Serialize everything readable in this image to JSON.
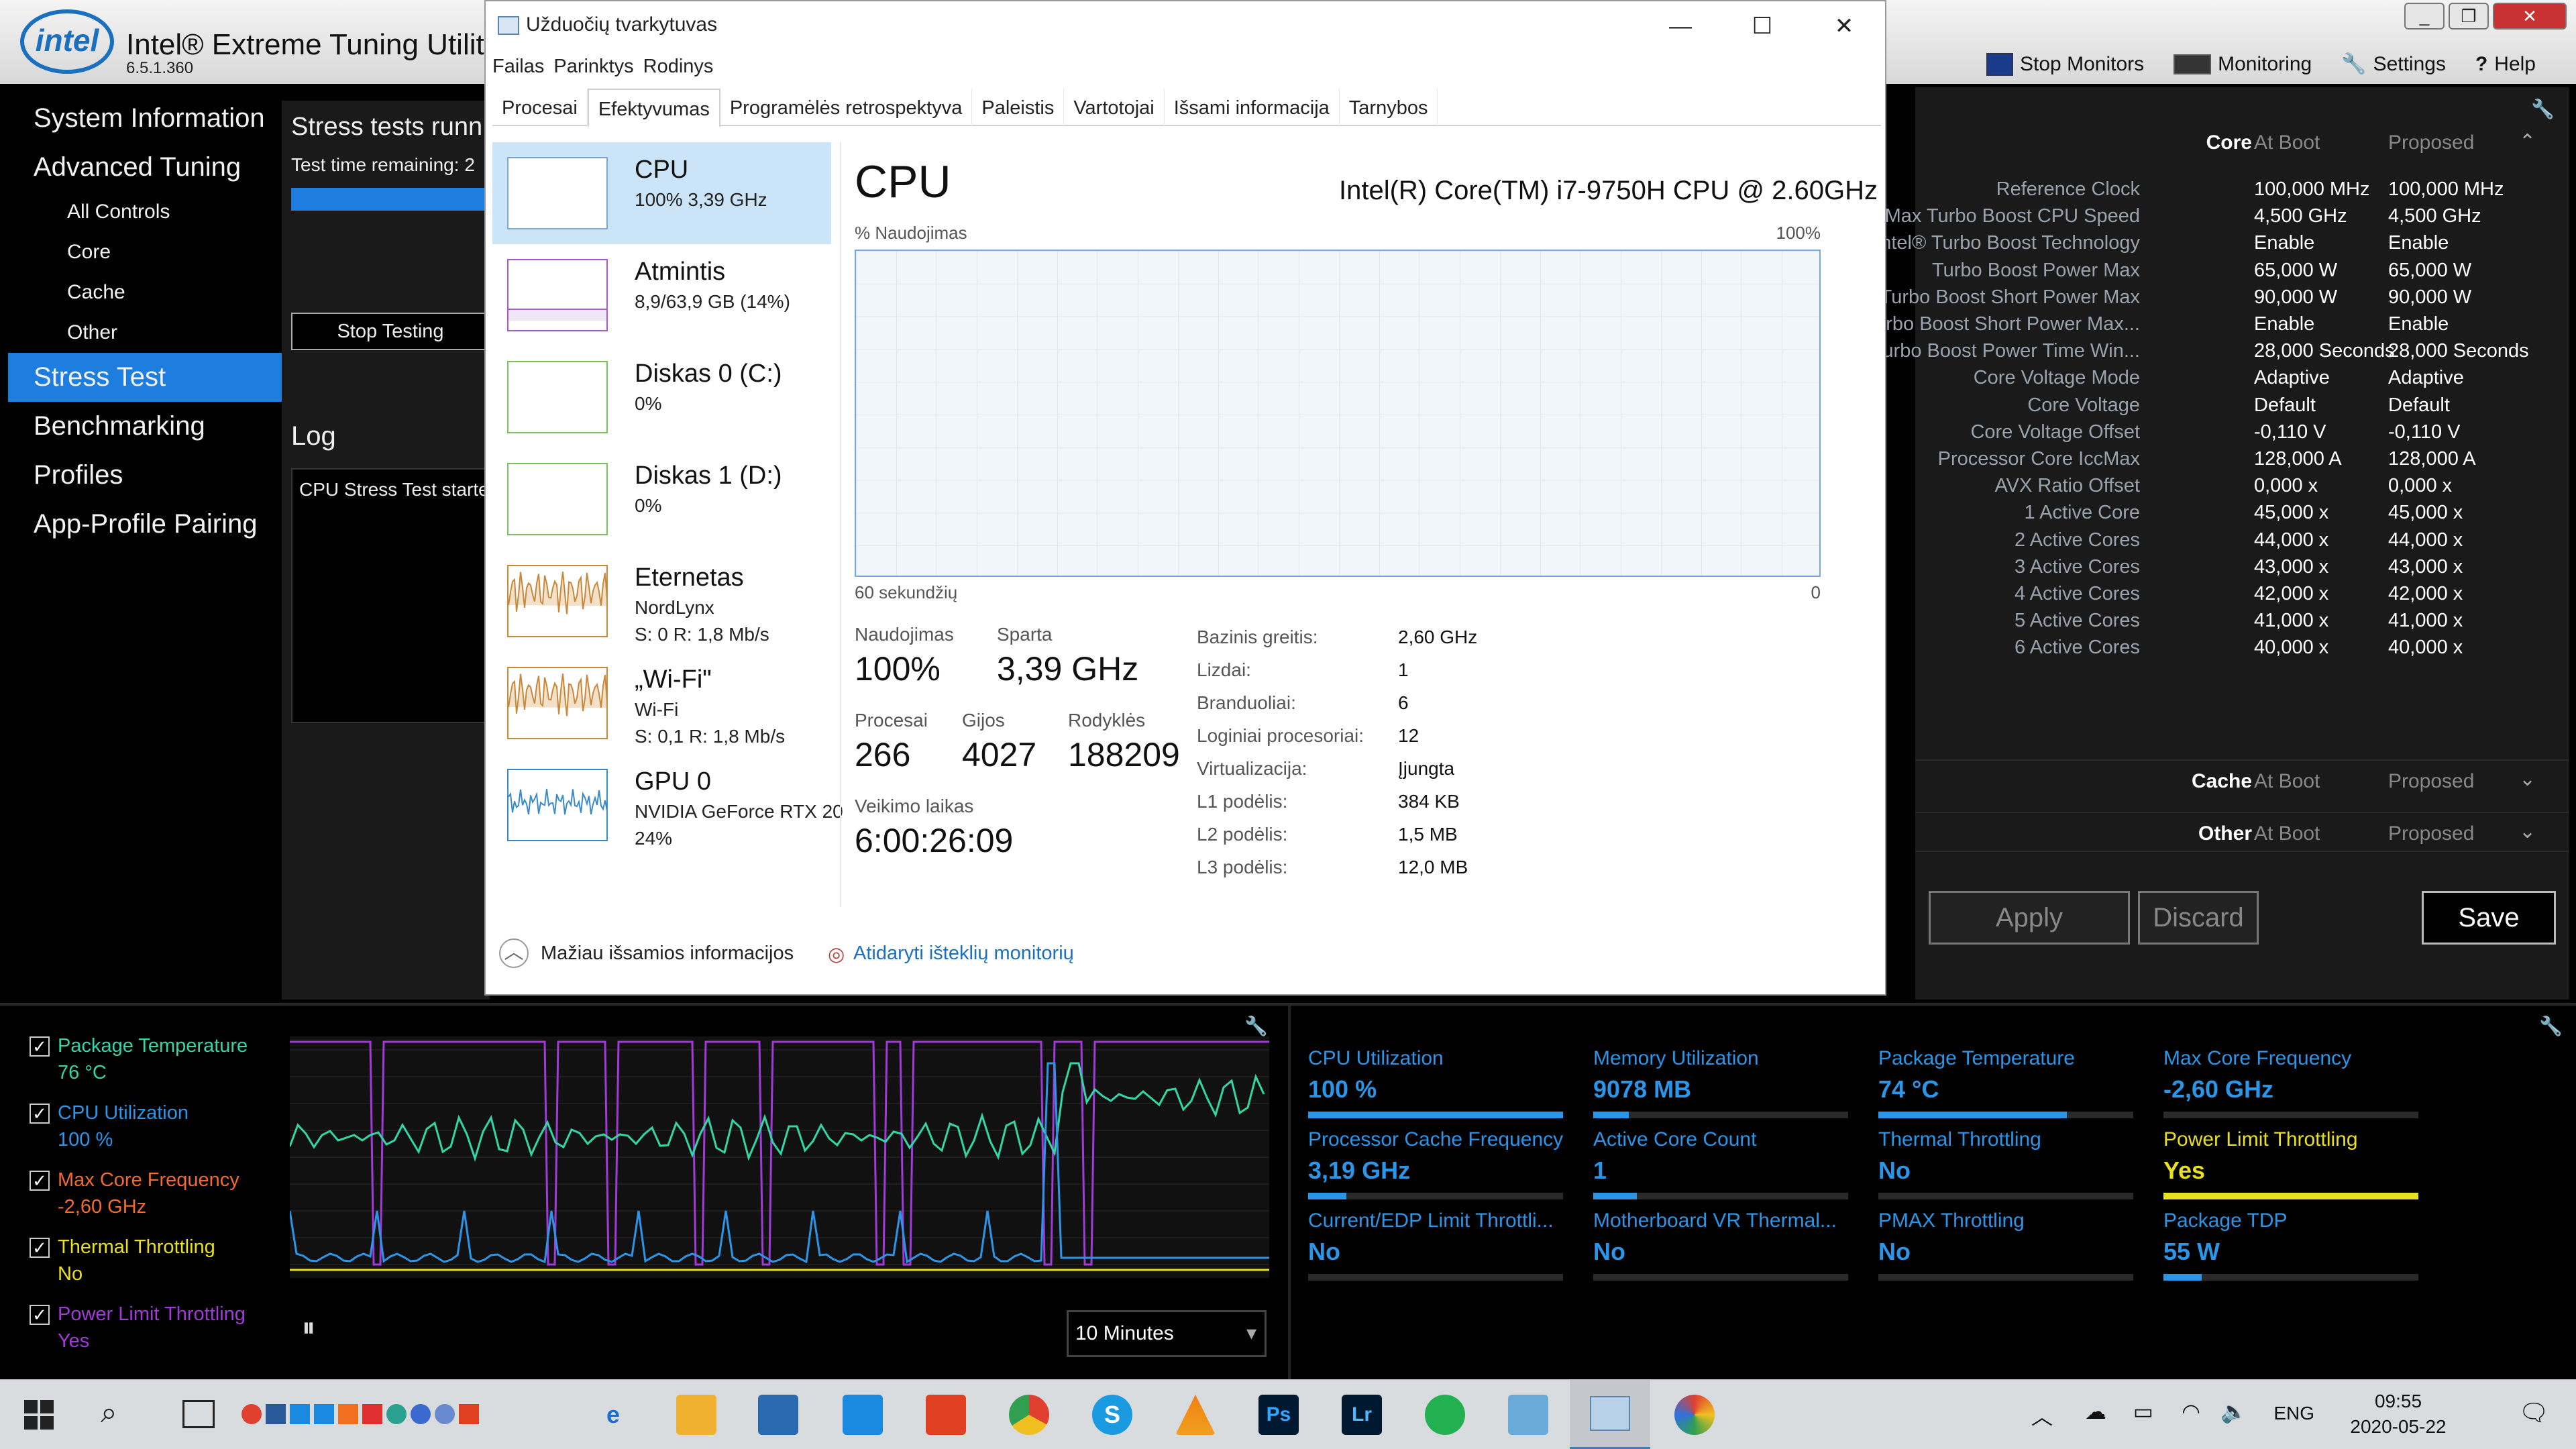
{
  "xtu": {
    "title": "Intel® Extreme Tuning Utility",
    "version": "6.5.1.360",
    "menu": [
      "Stop Monitors",
      "Monitoring",
      "Settings",
      "Help"
    ],
    "nav": [
      {
        "label": "System Information",
        "sub": false
      },
      {
        "label": "Advanced Tuning",
        "sub": false
      },
      {
        "label": "All Controls",
        "sub": true
      },
      {
        "label": "Core",
        "sub": true
      },
      {
        "label": "Cache",
        "sub": true
      },
      {
        "label": "Other",
        "sub": true
      },
      {
        "label": "Stress Test",
        "sub": false,
        "active": true
      },
      {
        "label": "Benchmarking",
        "sub": false
      },
      {
        "label": "Profiles",
        "sub": false
      },
      {
        "label": "App-Profile Pairing",
        "sub": false
      }
    ],
    "stress": {
      "title": "Stress tests runn",
      "time_label": "Test time remaining: 2",
      "stop_button": "Stop Testing",
      "log_title": "Log",
      "log_text": "CPU Stress Test starte"
    },
    "right": {
      "header": {
        "core": "Core",
        "at_boot": "At Boot",
        "proposed": "Proposed"
      },
      "rows": [
        {
          "label": "Reference Clock",
          "boot": "100,000 MHz",
          "prop": "100,000 MHz"
        },
        {
          "label": "Max Turbo Boost CPU Speed",
          "boot": "4,500 GHz",
          "prop": "4,500 GHz"
        },
        {
          "label": "Intel® Turbo Boost Technology",
          "boot": "Enable",
          "prop": "Enable"
        },
        {
          "label": "Turbo Boost Power Max",
          "boot": "65,000 W",
          "prop": "65,000 W"
        },
        {
          "label": "Turbo Boost Short Power Max",
          "boot": "90,000 W",
          "prop": "90,000 W"
        },
        {
          "label": "Turbo Boost Short Power Max...",
          "boot": "Enable",
          "prop": "Enable"
        },
        {
          "label": "Turbo Boost Power Time Win...",
          "boot": "28,000 Seconds",
          "prop": "28,000 Seconds"
        },
        {
          "label": "Core Voltage Mode",
          "boot": "Adaptive",
          "prop": "Adaptive"
        },
        {
          "label": "Core Voltage",
          "boot": "Default",
          "prop": "Default"
        },
        {
          "label": "Core Voltage Offset",
          "boot": "-0,110 V",
          "prop": "-0,110 V"
        },
        {
          "label": "Processor Core IccMax",
          "boot": "128,000 A",
          "prop": "128,000 A"
        },
        {
          "label": "AVX Ratio Offset",
          "boot": "0,000 x",
          "prop": "0,000 x"
        },
        {
          "label": "1 Active Core",
          "boot": "45,000 x",
          "prop": "45,000 x"
        },
        {
          "label": "2 Active Cores",
          "boot": "44,000 x",
          "prop": "44,000 x"
        },
        {
          "label": "3 Active Cores",
          "boot": "43,000 x",
          "prop": "43,000 x"
        },
        {
          "label": "4 Active Cores",
          "boot": "42,000 x",
          "prop": "42,000 x"
        },
        {
          "label": "5 Active Cores",
          "boot": "41,000 x",
          "prop": "41,000 x"
        },
        {
          "label": "6 Active Cores",
          "boot": "40,000 x",
          "prop": "40,000 x"
        }
      ],
      "cache": {
        "label": "Cache",
        "at_boot": "At Boot",
        "proposed": "Proposed"
      },
      "other": {
        "label": "Other",
        "at_boot": "At Boot",
        "proposed": "Proposed"
      },
      "buttons": {
        "apply": "Apply",
        "discard": "Discard",
        "save": "Save"
      }
    },
    "monitor": {
      "items": [
        {
          "name": "Package Temperature",
          "value": "76 °C",
          "color": "#33d6a6"
        },
        {
          "name": "CPU Utilization",
          "value": "100 %",
          "color": "#2b95e8"
        },
        {
          "name": "Max Core Frequency",
          "value": "-2,60 GHz",
          "color": "#f26b2a"
        },
        {
          "name": "Thermal Throttling",
          "value": "No",
          "color": "#e8e020"
        },
        {
          "name": "Power Limit Throttling",
          "value": "Yes",
          "color": "#a03ad8"
        }
      ],
      "time_range": "10 Minutes",
      "stats": [
        {
          "name": "CPU Utilization",
          "value": "100 %",
          "fill": 1.0,
          "color": "#2b95e8"
        },
        {
          "name": "Memory Utilization",
          "value": "9078  MB",
          "fill": 0.14,
          "color": "#2b95e8"
        },
        {
          "name": "Package Temperature",
          "value": "74 °C",
          "fill": 0.74,
          "color": "#2b95e8"
        },
        {
          "name": "Max Core Frequency",
          "value": "-2,60 GHz",
          "fill": 0,
          "color": "#2b95e8"
        },
        {
          "name": "Processor Cache Frequency",
          "value": "3,19 GHz",
          "fill": 0.15,
          "color": "#2b95e8"
        },
        {
          "name": "Active Core Count",
          "value": "1",
          "fill": 0.17,
          "color": "#2b95e8"
        },
        {
          "name": "Thermal Throttling",
          "value": "No",
          "fill": 0,
          "color": "#2b95e8"
        },
        {
          "name": "Power Limit Throttling",
          "value": "Yes",
          "fill": 1.0,
          "color": "#e8e020"
        },
        {
          "name": "Current/EDP Limit Throttli...",
          "value": "No",
          "fill": 0,
          "color": "#2b95e8"
        },
        {
          "name": "Motherboard VR Thermal...",
          "value": "No",
          "fill": 0,
          "color": "#2b95e8"
        },
        {
          "name": "PMAX Throttling",
          "value": "No",
          "fill": 0,
          "color": "#2b95e8"
        },
        {
          "name": "Package TDP",
          "value": "55 W",
          "fill": 0.15,
          "color": "#2b95e8"
        }
      ]
    }
  },
  "tm": {
    "title": "Užduočių tvarkytuvas",
    "menu": [
      "Failas",
      "Parinktys",
      "Rodinys"
    ],
    "tabs": [
      "Procesai",
      "Efektyvumas",
      "Programėlės retrospektyva",
      "Paleistis",
      "Vartotojai",
      "Išsami informacija",
      "Tarnybos"
    ],
    "active_tab": 1,
    "list": [
      {
        "name": "CPU",
        "s1": "100%  3,39 GHz",
        "s2": "",
        "color": "#7aa7d8"
      },
      {
        "name": "Atmintis",
        "s1": "8,9/63,9 GB (14%)",
        "s2": "",
        "color": "#a65cc8"
      },
      {
        "name": "Diskas 0 (C:)",
        "s1": "0%",
        "s2": "",
        "color": "#7ac060"
      },
      {
        "name": "Diskas 1 (D:)",
        "s1": "0%",
        "s2": "",
        "color": "#7ac060"
      },
      {
        "name": "Eternetas",
        "s1": "NordLynx",
        "s2": "S: 0  R: 1,8 Mb/s",
        "color": "#c8883a"
      },
      {
        "name": "„Wi-Fi\"",
        "s1": "Wi-Fi",
        "s2": "S: 0,1  R: 1,8 Mb/s",
        "color": "#c8883a"
      },
      {
        "name": "GPU 0",
        "s1": "NVIDIA GeForce RTX 20",
        "s2": "24%",
        "color": "#3a8ac8"
      }
    ],
    "cpu": {
      "title": "CPU",
      "model": "Intel(R) Core(TM) i7-9750H CPU @ 2.60GHz",
      "usage_label": "% Naudojimas",
      "max_label": "100%",
      "time_label": "60 sekundžių",
      "zero_label": "0",
      "stats": {
        "util_label": "Naudojimas",
        "util": "100%",
        "speed_label": "Sparta",
        "speed": "3,39 GHz",
        "proc_label": "Procesai",
        "proc": "266",
        "threads_label": "Gijos",
        "threads": "4027",
        "handles_label": "Rodyklės",
        "handles": "188209",
        "uptime_label": "Veikimo laikas",
        "uptime": "6:00:26:09"
      },
      "details": [
        {
          "k": "Bazinis greitis:",
          "v": "2,60 GHz"
        },
        {
          "k": "Lizdai:",
          "v": "1"
        },
        {
          "k": "Branduoliai:",
          "v": "6"
        },
        {
          "k": "Loginiai procesoriai:",
          "v": "12"
        },
        {
          "k": "Virtualizacija:",
          "v": "Įjungta"
        },
        {
          "k": "L1 podėlis:",
          "v": "384 KB"
        },
        {
          "k": "L2 podėlis:",
          "v": "1,5 MB"
        },
        {
          "k": "L3 podėlis:",
          "v": "12,0 MB"
        }
      ]
    },
    "footer": {
      "less": "Mažiau išsamios informacijos",
      "monitor": "Atidaryti išteklių monitorių"
    }
  },
  "taskbar": {
    "tray": {
      "lang": "ENG",
      "time": "09:55",
      "date": "2020-05-22"
    }
  }
}
